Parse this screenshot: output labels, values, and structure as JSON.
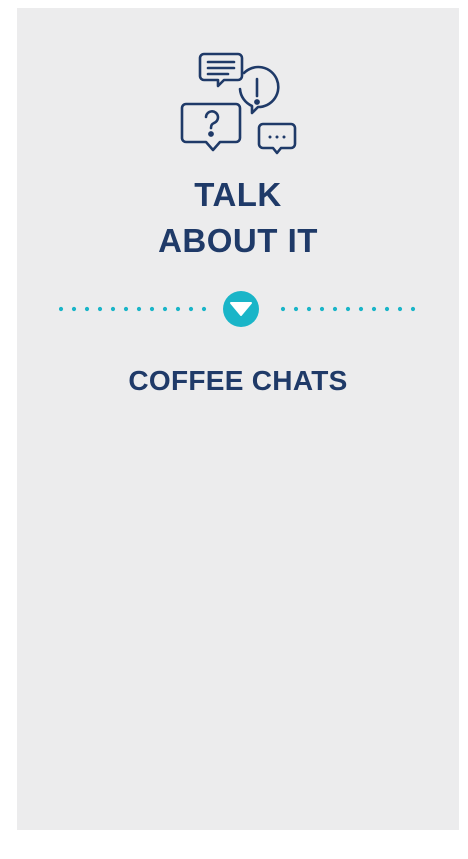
{
  "heading": {
    "line1": "TALK",
    "line2": "ABOUT IT"
  },
  "section": {
    "title": "COFFEE CHATS"
  },
  "icons": {
    "main": "speech-bubbles-icon",
    "divider": "chevron-down-circle-icon"
  },
  "colors": {
    "background": "#ececed",
    "heading": "#1f3a68",
    "accent": "#1ab5c8"
  }
}
